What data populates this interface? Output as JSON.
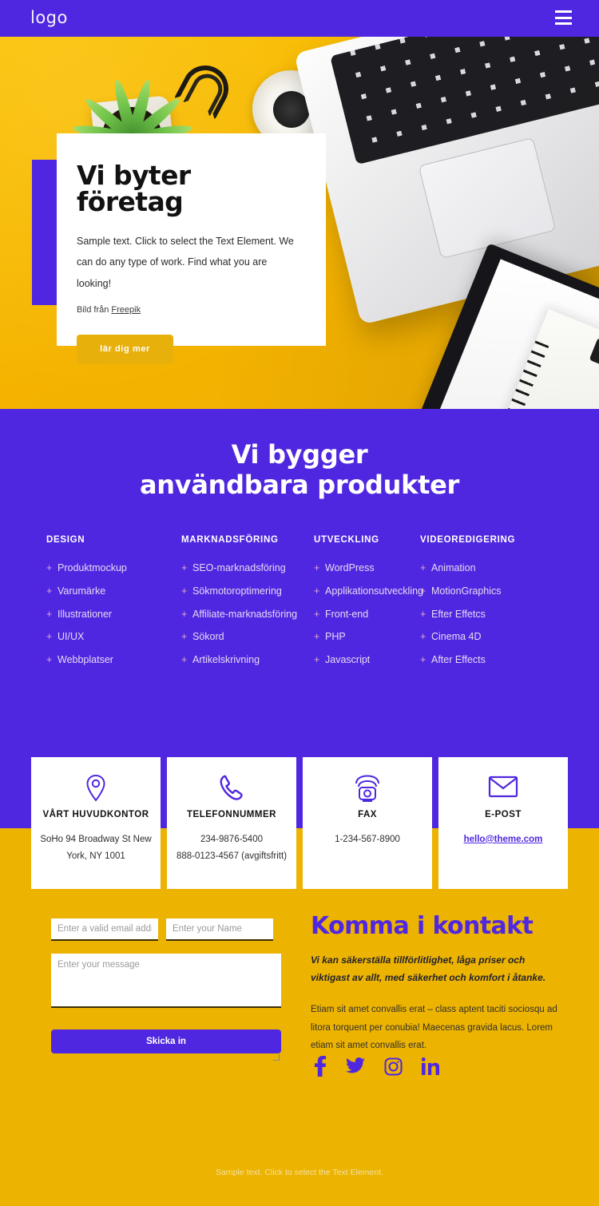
{
  "colors": {
    "purple": "#5027E0",
    "yellow": "#ECB301",
    "gold_button": "#E8B00B",
    "white": "#FFFFFF"
  },
  "header": {
    "logo": "logo",
    "menu_icon": "hamburger-menu-icon"
  },
  "hero": {
    "title": "Vi byter företag",
    "subtitle": "Sample text. Click to select the Text Element. We can do any type of work. Find what you are looking!",
    "credit_prefix": "Bild från ",
    "credit_link": "Freepik",
    "button": "lär dig mer"
  },
  "services": {
    "title_line1": "Vi bygger",
    "title_line2": "användbara produkter",
    "columns": [
      {
        "head": "DESIGN",
        "items": [
          "Produktmockup",
          "Varumärke",
          "Illustrationer",
          "UI/UX",
          "Webbplatser"
        ]
      },
      {
        "head": "MARKNADSFÖRING",
        "items": [
          "SEO-marknadsföring",
          "Sökmotoroptimering",
          "Affiliate-marknadsföring",
          "Sökord",
          "Artikelskrivning"
        ]
      },
      {
        "head": "UTVECKLING",
        "items": [
          "WordPress",
          "Applikationsutveckling",
          "Front-end",
          "PHP",
          "Javascript"
        ]
      },
      {
        "head": "VIDEOREDIGERING",
        "items": [
          "Animation",
          "MotionGraphics",
          "Efter Effetcs",
          "Cinema 4D",
          "After Effects"
        ]
      }
    ]
  },
  "contact_cards": [
    {
      "icon": "location-pin-icon",
      "title": "VÅRT HUVUDKONTOR",
      "lines": [
        "SoHo 94 Broadway St New York, NY 1001"
      ],
      "link": null
    },
    {
      "icon": "phone-handset-icon",
      "title": "TELEFONNUMMER",
      "lines": [
        "234-9876-5400",
        "888-0123-4567 (avgiftsfritt)"
      ],
      "link": null
    },
    {
      "icon": "fax-machine-icon",
      "title": "FAX",
      "lines": [
        "1-234-567-8900"
      ],
      "link": null
    },
    {
      "icon": "envelope-icon",
      "title": "E-POST",
      "lines": [],
      "link": "hello@theme.com"
    }
  ],
  "form": {
    "email_placeholder": "Enter a valid email address",
    "name_placeholder": "Enter your Name",
    "message_placeholder": "Enter your message",
    "submit_label": "Skicka in"
  },
  "kontakt": {
    "heading": "Komma i kontakt",
    "lead": "Vi kan säkerställa tillförlitlighet, låga priser och viktigast av allt, med säkerhet och komfort i åtanke.",
    "body": "Etiam sit amet convallis erat – class aptent taciti sociosqu ad litora torquent per conubia! Maecenas gravida lacus. Lorem etiam sit amet convallis erat."
  },
  "social": [
    {
      "name": "facebook-icon"
    },
    {
      "name": "twitter-icon"
    },
    {
      "name": "instagram-icon"
    },
    {
      "name": "linkedin-icon"
    }
  ],
  "footer": {
    "text": "Sample text. Click to select the Text Element."
  }
}
